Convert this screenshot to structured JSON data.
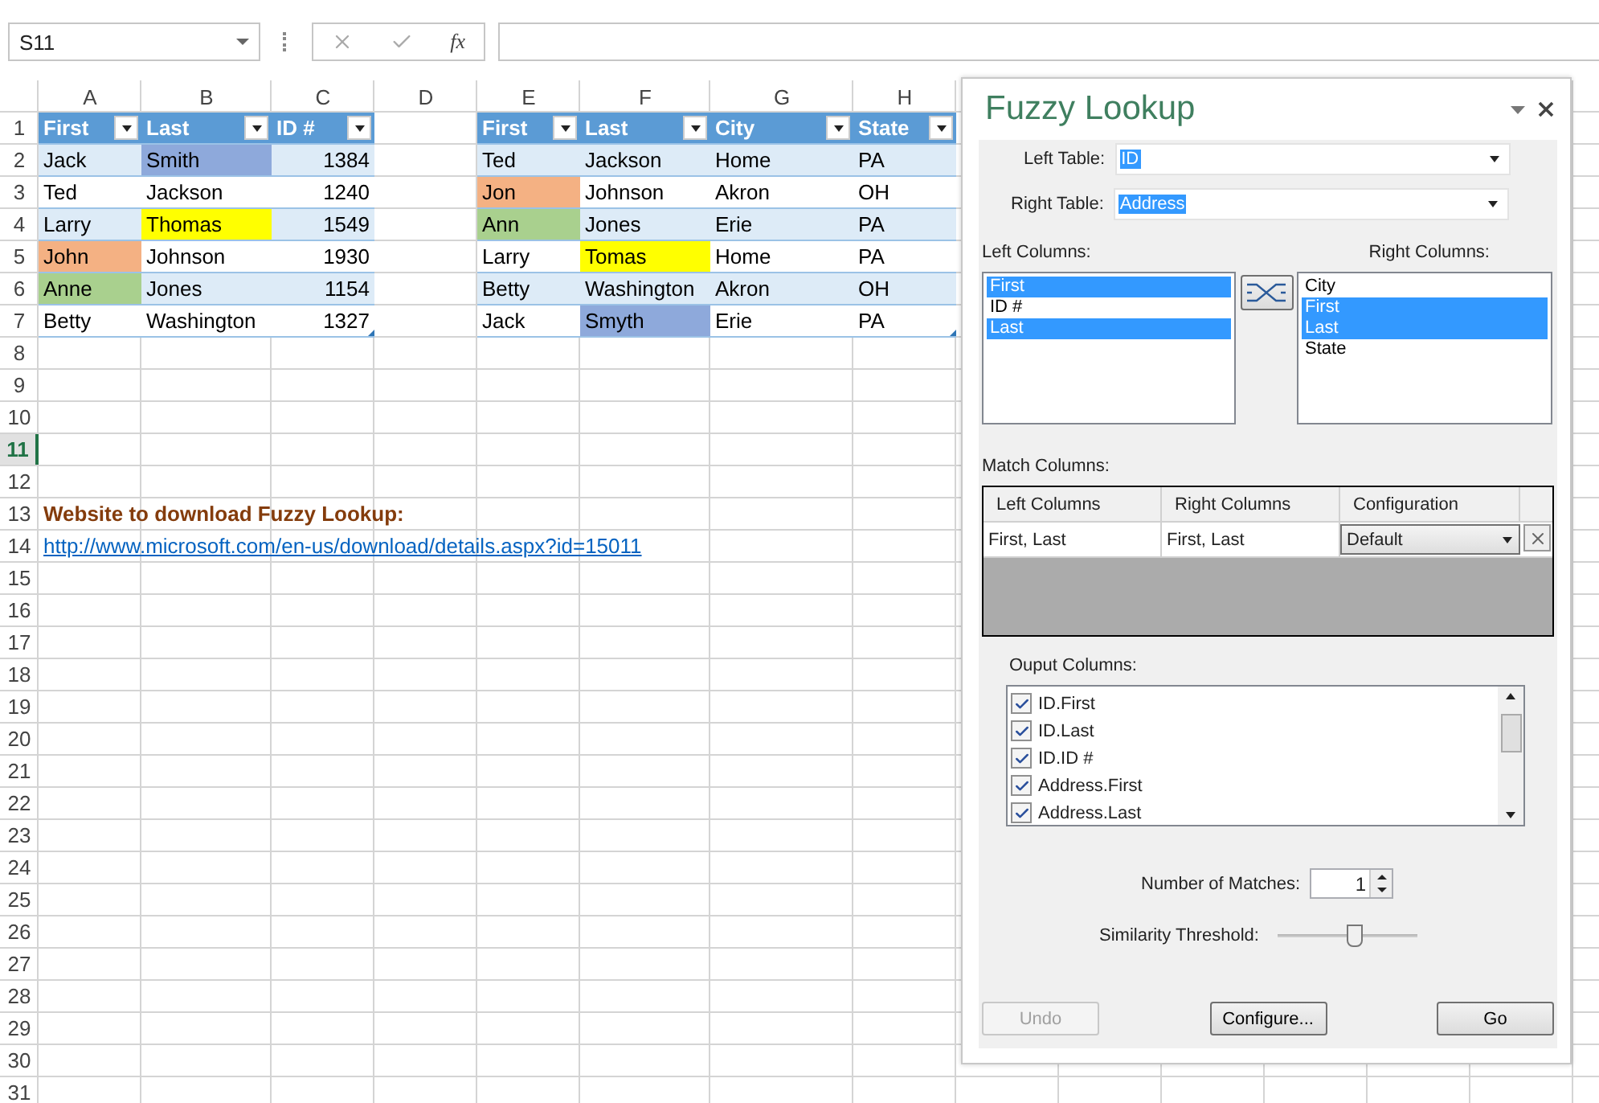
{
  "formula_bar": {
    "name_box": "S11",
    "function_label": "fx"
  },
  "sheet": {
    "columns": [
      "A",
      "B",
      "C",
      "D",
      "E",
      "F",
      "G",
      "H"
    ],
    "rows": [
      {
        "number": "1",
        "selected": false,
        "cells": [
          {
            "kind": "header",
            "text": "First"
          },
          {
            "kind": "header",
            "text": "Last"
          },
          {
            "kind": "header",
            "text": "ID #"
          },
          null,
          {
            "kind": "header",
            "text": "First"
          },
          {
            "kind": "header",
            "text": "Last"
          },
          {
            "kind": "header",
            "text": "City"
          },
          {
            "kind": "header",
            "text": "State"
          }
        ]
      },
      {
        "number": "2",
        "selected": false,
        "cells": [
          {
            "kind": "data",
            "text": "Jack",
            "banded": true
          },
          {
            "kind": "data",
            "text": "Smith",
            "color": "#8ea9db"
          },
          {
            "kind": "number",
            "text": "1384",
            "banded": true
          },
          null,
          {
            "kind": "data",
            "text": "Ted",
            "banded": true
          },
          {
            "kind": "data",
            "text": "Jackson",
            "banded": true
          },
          {
            "kind": "data",
            "text": "Home",
            "banded": true
          },
          {
            "kind": "data",
            "text": "PA",
            "banded": true
          }
        ]
      },
      {
        "number": "3",
        "selected": false,
        "cells": [
          {
            "kind": "data",
            "text": "Ted",
            "banded": false
          },
          {
            "kind": "data",
            "text": "Jackson",
            "banded": false
          },
          {
            "kind": "number",
            "text": "1240",
            "banded": false
          },
          null,
          {
            "kind": "data",
            "text": "Jon",
            "color": "#f4b183"
          },
          {
            "kind": "data",
            "text": "Johnson",
            "banded": false
          },
          {
            "kind": "data",
            "text": "Akron",
            "banded": false
          },
          {
            "kind": "data",
            "text": "OH",
            "banded": false
          }
        ]
      },
      {
        "number": "4",
        "selected": false,
        "cells": [
          {
            "kind": "data",
            "text": "Larry",
            "banded": true
          },
          {
            "kind": "data",
            "text": "Thomas",
            "color": "#ffff00"
          },
          {
            "kind": "number",
            "text": "1549",
            "banded": true
          },
          null,
          {
            "kind": "data",
            "text": "Ann",
            "color": "#a9d08e"
          },
          {
            "kind": "data",
            "text": "Jones",
            "banded": true
          },
          {
            "kind": "data",
            "text": "Erie",
            "banded": true
          },
          {
            "kind": "data",
            "text": "PA",
            "banded": true
          }
        ]
      },
      {
        "number": "5",
        "selected": false,
        "cells": [
          {
            "kind": "data",
            "text": "John",
            "color": "#f4b183"
          },
          {
            "kind": "data",
            "text": "Johnson",
            "banded": false
          },
          {
            "kind": "number",
            "text": "1930",
            "banded": false
          },
          null,
          {
            "kind": "data",
            "text": "Larry",
            "banded": false
          },
          {
            "kind": "data",
            "text": "Tomas",
            "color": "#ffff00"
          },
          {
            "kind": "data",
            "text": "Home",
            "banded": false
          },
          {
            "kind": "data",
            "text": "PA",
            "banded": false
          }
        ]
      },
      {
        "number": "6",
        "selected": false,
        "cells": [
          {
            "kind": "data",
            "text": "Anne",
            "color": "#a9d08e"
          },
          {
            "kind": "data",
            "text": "Jones",
            "banded": true
          },
          {
            "kind": "number",
            "text": "1154",
            "banded": true
          },
          null,
          {
            "kind": "data",
            "text": "Betty",
            "banded": true
          },
          {
            "kind": "data",
            "text": "Washington",
            "banded": true
          },
          {
            "kind": "data",
            "text": "Akron",
            "banded": true
          },
          {
            "kind": "data",
            "text": "OH",
            "banded": true
          }
        ]
      },
      {
        "number": "7",
        "selected": false,
        "cells": [
          {
            "kind": "data",
            "text": "Betty",
            "banded": false
          },
          {
            "kind": "data",
            "text": "Washington",
            "banded": false
          },
          {
            "kind": "number",
            "text": "1327",
            "banded": false,
            "resize_handle": true
          },
          null,
          {
            "kind": "data",
            "text": "Jack",
            "banded": false
          },
          {
            "kind": "data",
            "text": "Smyth",
            "color": "#8ea9db"
          },
          {
            "kind": "data",
            "text": "Erie",
            "banded": false
          },
          {
            "kind": "data",
            "text": "PA",
            "banded": false,
            "resize_handle": true
          }
        ]
      },
      {
        "number": "8",
        "selected": false
      },
      {
        "number": "9",
        "selected": false
      },
      {
        "number": "10",
        "selected": false
      },
      {
        "number": "11",
        "selected": true
      },
      {
        "number": "12",
        "selected": false
      },
      {
        "number": "13",
        "selected": false,
        "cells": [
          {
            "kind": "title",
            "text": "Website to download Fuzzy Lookup:"
          },
          null,
          null,
          null,
          null,
          null,
          null,
          null
        ]
      },
      {
        "number": "14",
        "selected": false,
        "cells": [
          {
            "kind": "link",
            "text": "http://www.microsoft.com/en-us/download/details.aspx?id=15011"
          },
          null,
          null,
          null,
          null,
          null,
          null,
          null
        ]
      },
      {
        "number": "15",
        "selected": false
      },
      {
        "number": "16",
        "selected": false
      },
      {
        "number": "17",
        "selected": false
      },
      {
        "number": "18",
        "selected": false
      },
      {
        "number": "19",
        "selected": false
      },
      {
        "number": "20",
        "selected": false
      },
      {
        "number": "21",
        "selected": false
      },
      {
        "number": "22",
        "selected": false
      },
      {
        "number": "23",
        "selected": false
      },
      {
        "number": "24",
        "selected": false
      },
      {
        "number": "25",
        "selected": false
      },
      {
        "number": "26",
        "selected": false
      },
      {
        "number": "27",
        "selected": false
      },
      {
        "number": "28",
        "selected": false
      },
      {
        "number": "29",
        "selected": false
      },
      {
        "number": "30",
        "selected": false
      },
      {
        "number": "31",
        "selected": false
      }
    ]
  },
  "fuzzy_lookup": {
    "title": "Fuzzy Lookup",
    "left_table": {
      "label": "Left Table:",
      "value": "ID"
    },
    "right_table": {
      "label": "Right Table:",
      "value": "Address"
    },
    "left_columns": {
      "label": "Left Columns:",
      "items": [
        {
          "text": "First",
          "selected": true
        },
        {
          "text": "ID #",
          "selected": false
        },
        {
          "text": "Last",
          "selected": true
        }
      ]
    },
    "right_columns": {
      "label": "Right Columns:",
      "items": [
        {
          "text": "City",
          "selected": false
        },
        {
          "text": "First",
          "selected": true
        },
        {
          "text": "Last",
          "selected": true
        },
        {
          "text": "State",
          "selected": false
        }
      ]
    },
    "match_columns": {
      "label": "Match Columns:",
      "headers": [
        "Left Columns",
        "Right Columns",
        "Configuration"
      ],
      "rows": [
        {
          "left": "First, Last",
          "right": "First, Last",
          "configuration": "Default"
        }
      ]
    },
    "output_columns": {
      "label": "Ouput Columns:",
      "items": [
        {
          "text": "ID.First",
          "checked": true
        },
        {
          "text": "ID.Last",
          "checked": true
        },
        {
          "text": "ID.ID #",
          "checked": true
        },
        {
          "text": "Address.First",
          "checked": true
        },
        {
          "text": "Address.Last",
          "checked": true
        }
      ]
    },
    "number_of_matches": {
      "label": "Number of Matches:",
      "value": "1"
    },
    "similarity_threshold": {
      "label": "Similarity Threshold:",
      "level": 0.52
    },
    "buttons": [
      {
        "text": "Undo",
        "disabled": true
      },
      {
        "text": "Configure...",
        "disabled": false
      },
      {
        "text": "Go",
        "disabled": false
      }
    ]
  }
}
